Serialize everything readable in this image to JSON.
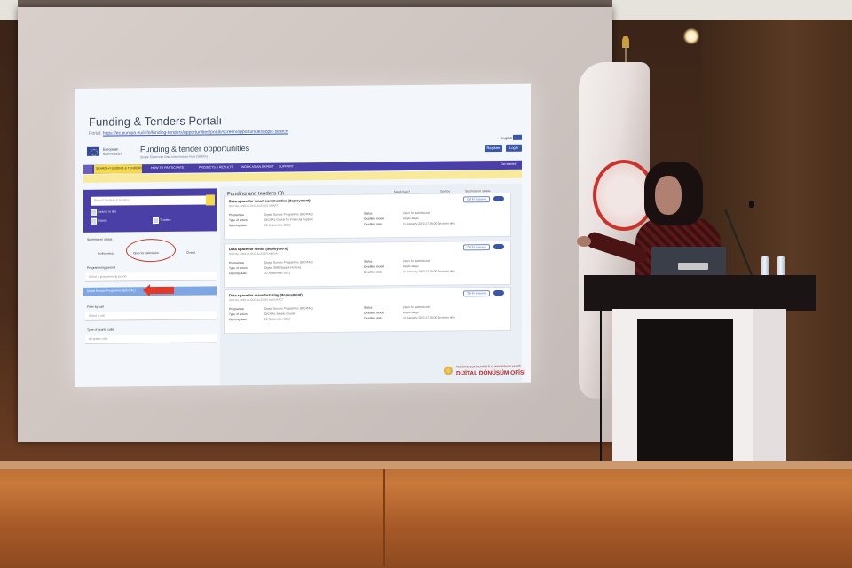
{
  "scene": "conference presentation photo",
  "slide": {
    "title": "Funding & Tenders Portalı",
    "portal_prefix": "Portal:",
    "portal_link": "https://ec.europa.eu/info/funding-tenders/opportunities/portal/screen/opportunities/topic-search",
    "language_label": "English",
    "language_badge": "EN",
    "ec_line1": "European",
    "ec_line2": "Commission",
    "page_title": "Funding & tender opportunities",
    "page_subtitle": "Single Electronic Data Interchange Area (SEDIA)",
    "register_label": "Register",
    "login_label": "Login",
    "nav": [
      "SEARCH FUNDING & TENDERS",
      "HOW TO PARTICIPATE",
      "PROJECTS & RESULTS",
      "WORK AS AN EXPERT",
      "SUPPORT"
    ],
    "get_started": "Get started",
    "search_placeholder": "Search funding & tenders",
    "search_in_title": "Search in title",
    "checkbox_grants": "Grants",
    "checkbox_tenders": "Tenders",
    "submission_status_label": "Submission status",
    "radio_forthcoming": "Forthcoming",
    "radio_open": "Open for submission",
    "radio_closed": "Closed",
    "programming_period_label": "Programming period",
    "programming_period_value": "Select a programming period",
    "programme_selected": "Digital Europe Programme (DIGITAL)",
    "filter_by_call_label": "Filter by call",
    "filter_by_call_value": "Select a call",
    "type_of_calls_label": "Type of grants calls",
    "type_of_calls_value": "All grants calls",
    "results_title": "Funding and tenders (8)",
    "results_controls": [
      "Need help?",
      "Sort by",
      "Submission status"
    ],
    "cards": [
      {
        "title": "Data space for smart communities (deployment)",
        "id": "DIGITAL-2022-CLOUD-AI-03-DS-SMART",
        "programme": "Digital Europe Programme (DIGITAL)",
        "type_of_action": "DIGITAL Grants for Financial Support",
        "opening_date": "22 September 2022",
        "status": "Open for submission",
        "deadline_model": "single-stage",
        "deadline_date": "24 January 2023 17:00:00 Brussels time"
      },
      {
        "title": "Data space for media (deployment)",
        "id": "DIGITAL-2022-CLOUD-AI-03-DS-MEDIA",
        "programme": "Digital Europe Programme (DIGITAL)",
        "type_of_action": "Digital SME Support Actions",
        "opening_date": "22 September 2022",
        "status": "Open for submission",
        "deadline_model": "single-stage",
        "deadline_date": "24 January 2023 17:00:00 Brussels time"
      },
      {
        "title": "Data space for manufacturing (deployment)",
        "id": "DIGITAL-2022-CLOUD-AI-03-DS-MANUFACT",
        "programme": "Digital Europe Programme (DIGITAL)",
        "type_of_action": "DIGITAL Simple Grants",
        "opening_date": "22 September 2022",
        "status": "Open for submission",
        "deadline_model": "single-stage",
        "deadline_date": "24 January 2023 17:00:00 Brussels time"
      }
    ],
    "field_labels": {
      "programme": "Programme",
      "type_of_action": "Type of action",
      "opening_date": "Opening date",
      "status": "Status",
      "deadline_model": "Deadline model",
      "deadline_date": "Deadline date"
    },
    "card_chip": "Call for proposals",
    "footer_small": "TÜRKİYE CUMHURİYETİ CUMHURBAŞKANLIĞI",
    "footer_big": "DİJİTAL DÖNÜŞÜM OFİSİ"
  },
  "flag_emblem_text": "TÜRKİYE CUMHURİYETİ"
}
